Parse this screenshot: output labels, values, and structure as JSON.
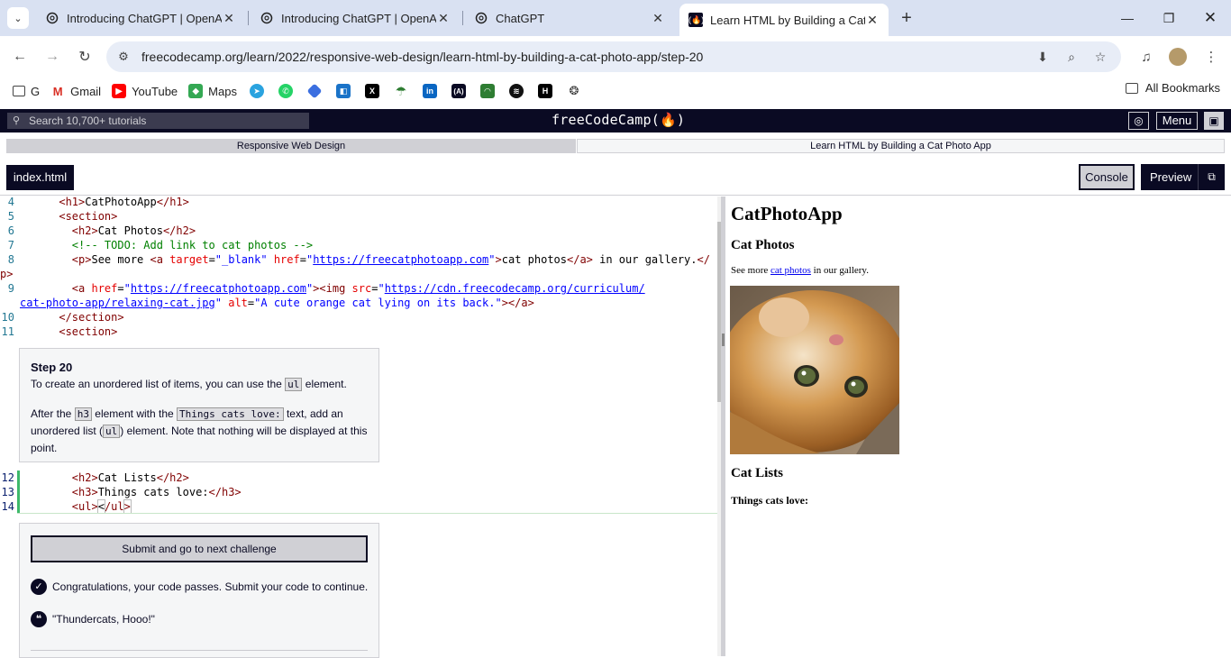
{
  "browser": {
    "tabs": [
      {
        "title": "Introducing ChatGPT | OpenAI",
        "active": false
      },
      {
        "title": "Introducing ChatGPT | OpenAI",
        "active": false
      },
      {
        "title": "ChatGPT",
        "active": false
      },
      {
        "title": "Learn HTML by Building a Cat Photo App",
        "active": true
      }
    ],
    "url": "freecodecamp.org/learn/2022/responsive-web-design/learn-html-by-building-a-cat-photo-app/step-20",
    "bookmarks": [
      {
        "label": "G",
        "icon": "folder-icon"
      },
      {
        "label": "Gmail",
        "icon": "gmail-icon"
      },
      {
        "label": "YouTube",
        "icon": "youtube-icon"
      },
      {
        "label": "Maps",
        "icon": "maps-icon"
      }
    ],
    "bookmark_icons": [
      "telegram-icon",
      "whatsapp-icon",
      "app-icon",
      "outlook-icon",
      "x-icon",
      "app-icon",
      "linkedin-icon",
      "freecodecamp-icon",
      "android-icon",
      "spotify-icon",
      "hackernoon-icon",
      "chatgpt-icon"
    ],
    "all_bookmarks": "All Bookmarks"
  },
  "fcc": {
    "search_placeholder": "Search 10,700+ tutorials",
    "logo": "freeCodeCamp(🔥)",
    "menu": "Menu",
    "breadcrumb": {
      "course": "Responsive Web Design",
      "project": "Learn HTML by Building a Cat Photo App"
    },
    "file_tab": "index.html",
    "console": "Console",
    "preview": "Preview"
  },
  "code_top": [
    {
      "n": "4"
    },
    {
      "n": "5"
    },
    {
      "n": "6"
    },
    {
      "n": "7"
    },
    {
      "n": "8"
    },
    {
      "n": ""
    },
    {
      "n": "9"
    },
    {
      "n": ""
    },
    {
      "n": "10"
    },
    {
      "n": "11"
    }
  ],
  "step": {
    "title": "Step 20",
    "p1_pre": "To create an unordered list of items, you can use the",
    "p1_code": "ul",
    "p1_post": "element.",
    "p2_a": "After the",
    "p2_code1": "h3",
    "p2_b": "element with the",
    "p2_code2": "Things cats love:",
    "p2_c": "text, add an unordered list (",
    "p2_code3": "ul",
    "p2_d": ") element. Note that nothing will be displayed at this point."
  },
  "code_bottom": [
    {
      "n": "12"
    },
    {
      "n": "13"
    },
    {
      "n": "14"
    }
  ],
  "submit": {
    "button": "Submit and go to next challenge",
    "success": "Congratulations, your code passes. Submit your code to continue.",
    "quote": "\"Thundercats, Hooo!\""
  },
  "preview_page": {
    "h1": "CatPhotoApp",
    "h2a": "Cat Photos",
    "p_pre": "See more ",
    "p_link": "cat photos",
    "p_post": " in our gallery.",
    "h2b": "Cat Lists",
    "h3": "Things cats love:"
  }
}
